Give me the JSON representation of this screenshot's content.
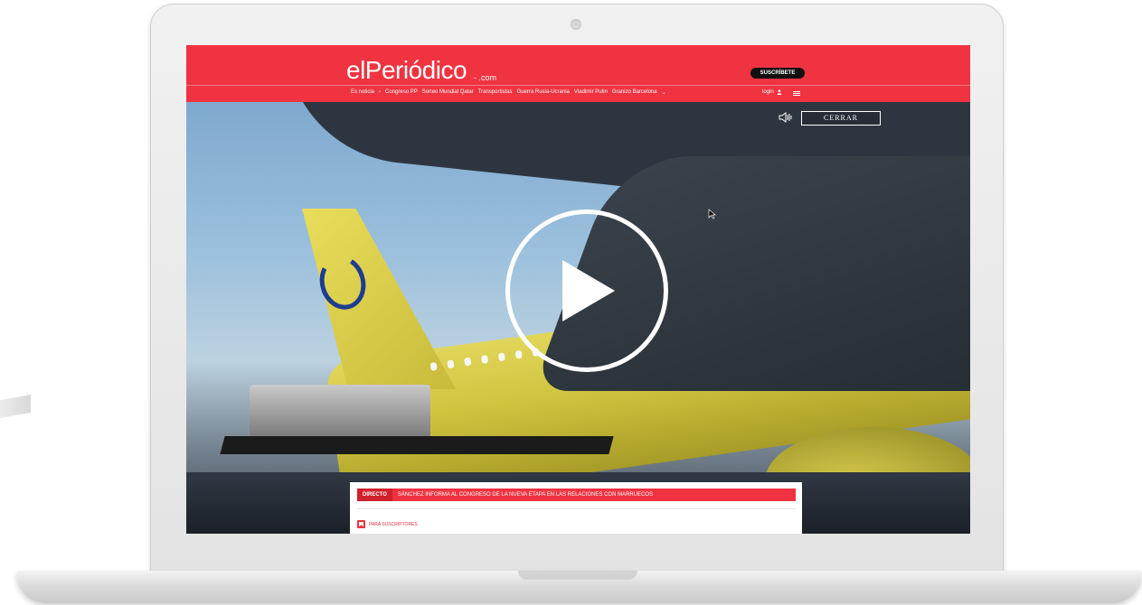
{
  "header": {
    "logo": "elPeriódico",
    "logo_suffix": "- .com",
    "subscribe_label": "SUSCRÍBETE",
    "login_label": "login",
    "nav_items": [
      "Es noticia",
      "›",
      "Congreso PP",
      "Sorteo Mundial Qatar",
      "Transportistas",
      "Guerra Rusia-Ucrania",
      "Vladimir Putin",
      "Granizo Barcelona",
      "⌄"
    ]
  },
  "video": {
    "close_label": "CERRAR"
  },
  "banner": {
    "live_tag": "DIRECTO",
    "live_text": "SÁNCHEZ INFORMA AL CONGRESO DE LA NUEVA ETAPA EN LAS RELACIONES CON MARRUECOS",
    "subscribers_label": "PARA SUSCRIPTORES"
  },
  "colors": {
    "brand_red": "#ef3340",
    "laptop_frame": "#e9e9e9"
  }
}
